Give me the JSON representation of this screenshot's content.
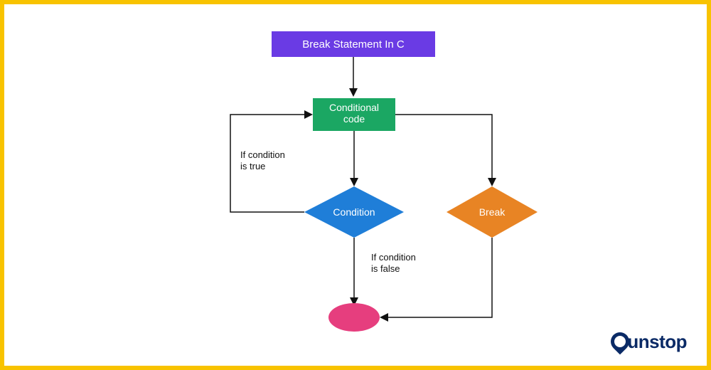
{
  "title": "Break Statement In C",
  "nodes": {
    "cond_code_l1": "Conditional",
    "cond_code_l2": "code",
    "condition": "Condition",
    "break": "Break"
  },
  "annotations": {
    "true_l1": "If condition",
    "true_l2": "is true",
    "false_l1": "If condition",
    "false_l2": "is false"
  },
  "brand": {
    "part1": "un",
    "part2": "stop"
  },
  "chart_data": {
    "type": "flowchart",
    "title": "Break Statement In C",
    "nodes": [
      {
        "id": "title",
        "shape": "rect",
        "label": "Break Statement In C",
        "color": "#6a3be4"
      },
      {
        "id": "cond_code",
        "shape": "rect",
        "label": "Conditional code",
        "color": "#1ba763"
      },
      {
        "id": "condition",
        "shape": "diamond",
        "label": "Condition",
        "color": "#1f7ed8"
      },
      {
        "id": "break",
        "shape": "diamond",
        "label": "Break",
        "color": "#e88424"
      },
      {
        "id": "end",
        "shape": "ellipse",
        "label": "",
        "color": "#e63e7e"
      }
    ],
    "edges": [
      {
        "from": "title",
        "to": "cond_code",
        "label": ""
      },
      {
        "from": "cond_code",
        "to": "condition",
        "label": ""
      },
      {
        "from": "condition",
        "to": "cond_code",
        "label": "If condition is true",
        "path": "left-loop"
      },
      {
        "from": "condition",
        "to": "end",
        "label": "If condition is false"
      },
      {
        "from": "cond_code",
        "to": "break",
        "label": "",
        "path": "right"
      },
      {
        "from": "break",
        "to": "end",
        "label": "",
        "path": "right-down"
      }
    ]
  }
}
